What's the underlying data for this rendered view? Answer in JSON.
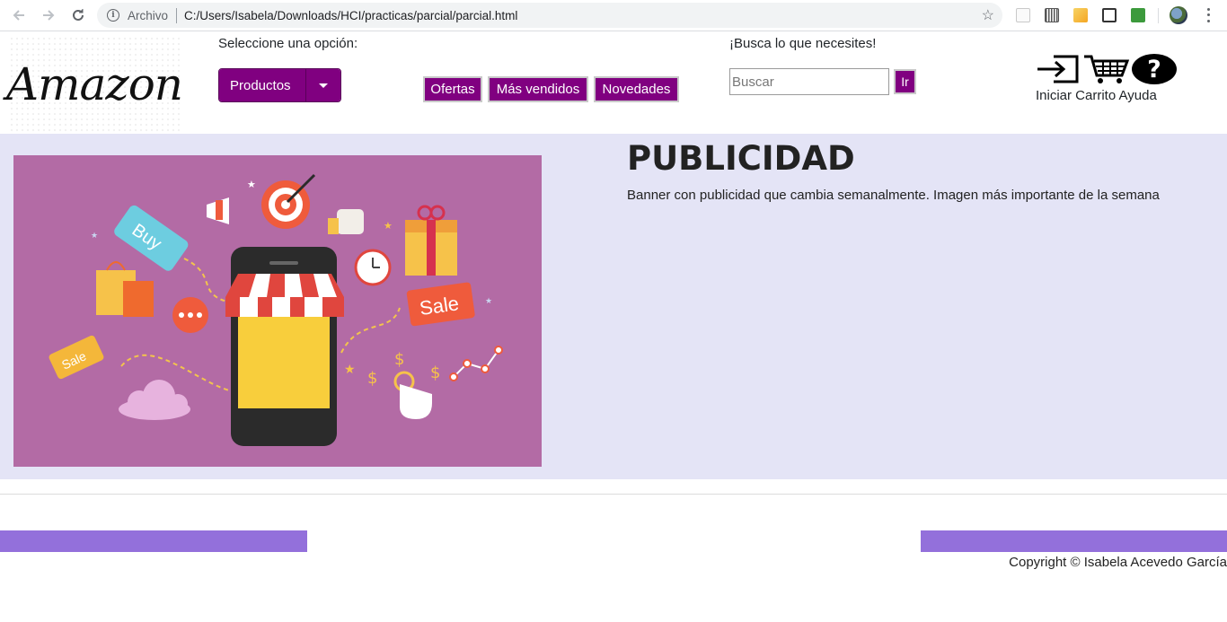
{
  "browser": {
    "scheme_label": "Archivo",
    "url": "C:/Users/Isabela/Downloads/HCI/practicas/parcial/parcial.html",
    "icons": [
      "back-icon",
      "forward-icon",
      "reload-icon",
      "info-icon",
      "star-icon",
      "menu-icon"
    ]
  },
  "header": {
    "logo_text": "Amazon",
    "select_label": "Seleccione una opción:",
    "dropdown_label": "Productos",
    "tabs": [
      "Ofertas",
      "Más vendidos",
      "Novedades"
    ],
    "search_label": "¡Busca lo que necesites!",
    "search_placeholder": "Buscar",
    "search_button": "Ir",
    "icon_labels": "Iniciar Carrito Ayuda"
  },
  "banner": {
    "title": "PUBLICIDAD",
    "text": "Banner con publicidad que cambia semanalmente. Imagen más importante de la semana",
    "image_tags": [
      "Buy",
      "Sale",
      "Sale"
    ]
  },
  "footer": {
    "copyright": "Copyright © Isabela Acevedo García"
  },
  "colors": {
    "accent": "#800080",
    "banner_bg": "#e4e4f6",
    "promo_bg": "#b36ba5",
    "footer_bar": "#9370db"
  }
}
